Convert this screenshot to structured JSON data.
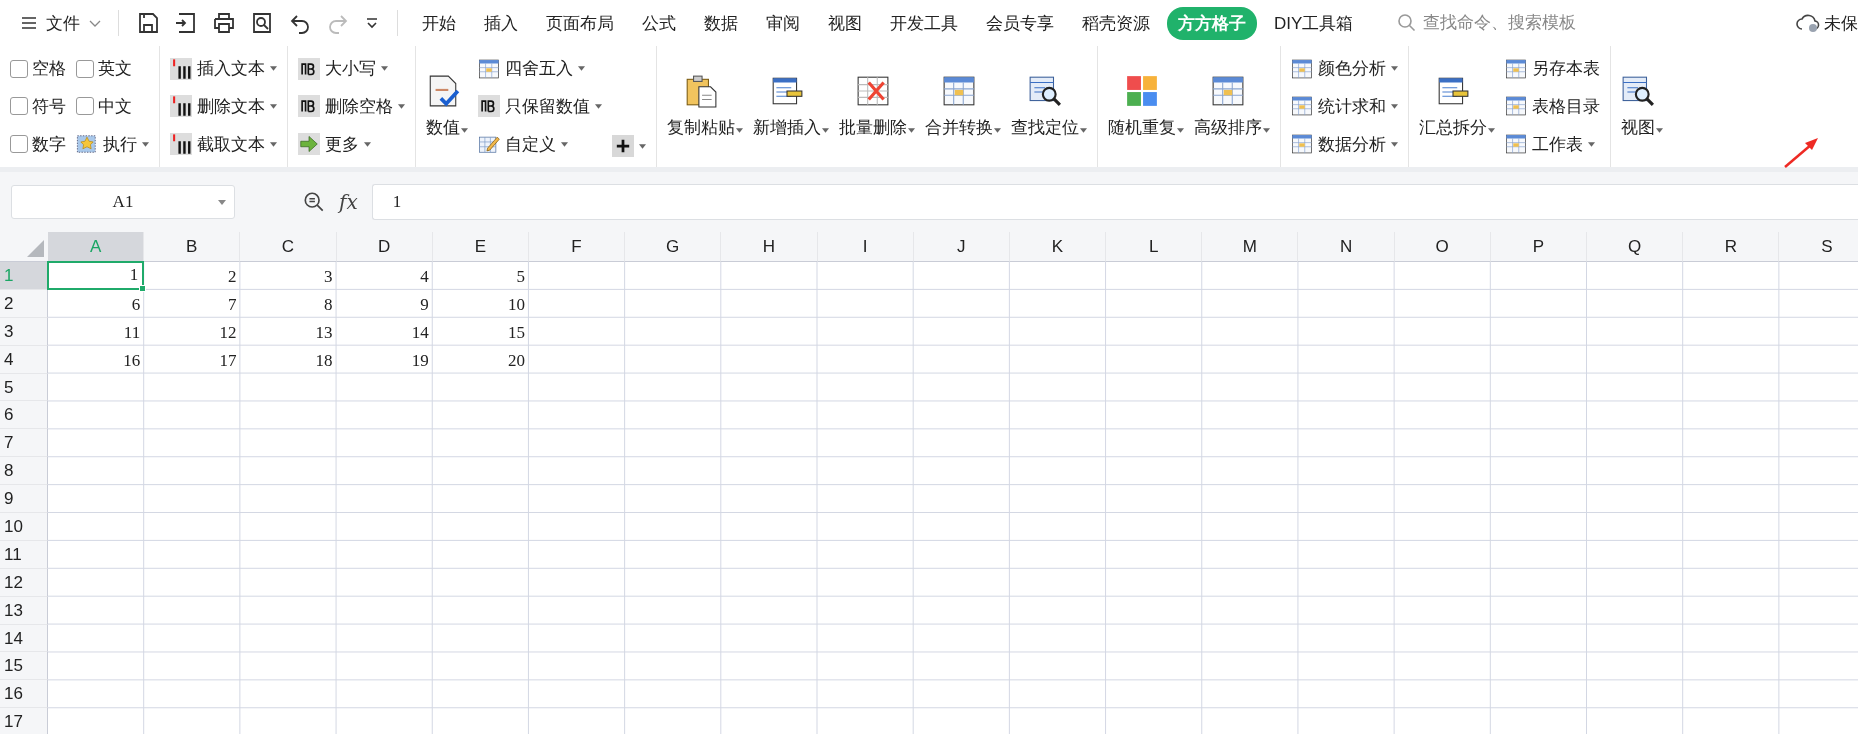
{
  "menu_bar": {
    "file_menu": "文件",
    "tabs": [
      {
        "label": "开始",
        "selected": false
      },
      {
        "label": "插入",
        "selected": false
      },
      {
        "label": "页面布局",
        "selected": false
      },
      {
        "label": "公式",
        "selected": false
      },
      {
        "label": "数据",
        "selected": false
      },
      {
        "label": "审阅",
        "selected": false
      },
      {
        "label": "视图",
        "selected": false
      },
      {
        "label": "开发工具",
        "selected": false
      },
      {
        "label": "会员专享",
        "selected": false
      },
      {
        "label": "稻壳资源",
        "selected": false
      },
      {
        "label": "方方格子",
        "selected": true
      },
      {
        "label": "DIY工具箱",
        "selected": false
      }
    ],
    "search": {
      "placeholder": "查找命令、搜索模板"
    },
    "cloud_status": "未保"
  },
  "ribbon": {
    "groups": [
      {
        "columns": [
          [
            {
              "kind": "checkbox",
              "label": "空格",
              "checked": false
            },
            {
              "kind": "checkbox",
              "label": "符号",
              "checked": false
            },
            {
              "kind": "checkbox",
              "label": "数字",
              "checked": false
            }
          ],
          [
            {
              "kind": "checkbox",
              "label": "英文",
              "checked": false
            },
            {
              "kind": "checkbox",
              "label": "中文",
              "checked": false
            },
            {
              "kind": "small",
              "label": "执行",
              "dropdown": true
            }
          ]
        ]
      },
      {
        "columns": [
          [
            {
              "kind": "small",
              "label": "插入文本",
              "dropdown": true
            },
            {
              "kind": "small",
              "label": "删除文本",
              "dropdown": true
            },
            {
              "kind": "small",
              "label": "截取文本",
              "dropdown": true
            }
          ]
        ]
      },
      {
        "columns": [
          [
            {
              "kind": "small",
              "label": "大小写",
              "dropdown": true
            },
            {
              "kind": "small",
              "label": "删除空格",
              "dropdown": true
            },
            {
              "kind": "small",
              "label": "更多",
              "dropdown": true
            }
          ]
        ]
      },
      {
        "columns": [
          [
            {
              "kind": "large",
              "label": "数值",
              "dropdown": true
            }
          ],
          [
            {
              "kind": "small",
              "label": "四舍五入",
              "dropdown": true
            },
            {
              "kind": "small",
              "label": "只保留数值",
              "dropdown": true
            },
            {
              "kind": "small",
              "label": "自定义",
              "dropdown": true
            }
          ],
          [
            {
              "kind": "icon",
              "dropdown": true
            }
          ]
        ]
      },
      {
        "columns": [
          [
            {
              "kind": "large",
              "label": "复制粘贴",
              "dropdown": true
            }
          ],
          [
            {
              "kind": "large",
              "label": "新增插入",
              "dropdown": true
            }
          ],
          [
            {
              "kind": "large",
              "label": "批量删除",
              "dropdown": true
            }
          ],
          [
            {
              "kind": "large",
              "label": "合并转换",
              "dropdown": true
            }
          ],
          [
            {
              "kind": "large",
              "label": "查找定位",
              "dropdown": true
            }
          ]
        ]
      },
      {
        "columns": [
          [
            {
              "kind": "large",
              "label": "随机重复",
              "dropdown": true
            }
          ],
          [
            {
              "kind": "large",
              "label": "高级排序",
              "dropdown": true
            }
          ]
        ]
      },
      {
        "columns": [
          [
            {
              "kind": "small",
              "label": "颜色分析",
              "dropdown": true
            },
            {
              "kind": "small",
              "label": "统计求和",
              "dropdown": true
            },
            {
              "kind": "small",
              "label": "数据分析",
              "dropdown": true
            }
          ]
        ]
      },
      {
        "columns": [
          [
            {
              "kind": "large",
              "label": "汇总拆分",
              "dropdown": true
            }
          ],
          [
            {
              "kind": "small",
              "label": "另存本表",
              "dropdown": false
            },
            {
              "kind": "small",
              "label": "表格目录",
              "dropdown": false
            },
            {
              "kind": "small",
              "label": "工作表",
              "dropdown": true
            }
          ]
        ]
      },
      {
        "columns": [
          [
            {
              "kind": "large",
              "label": "视图",
              "dropdown": true
            }
          ]
        ]
      }
    ]
  },
  "formula_bar": {
    "name_box": "A1",
    "function_label": "fx",
    "formula": "1"
  },
  "sheet": {
    "columns": [
      {
        "label": "A",
        "selected": true
      },
      {
        "label": "B",
        "selected": false
      },
      {
        "label": "C",
        "selected": false
      },
      {
        "label": "D",
        "selected": false
      },
      {
        "label": "E",
        "selected": false
      },
      {
        "label": "F",
        "selected": false
      },
      {
        "label": "G",
        "selected": false
      },
      {
        "label": "H",
        "selected": false
      },
      {
        "label": "I",
        "selected": false
      },
      {
        "label": "J",
        "selected": false
      },
      {
        "label": "K",
        "selected": false
      },
      {
        "label": "L",
        "selected": false
      },
      {
        "label": "M",
        "selected": false
      },
      {
        "label": "N",
        "selected": false
      },
      {
        "label": "O",
        "selected": false
      },
      {
        "label": "P",
        "selected": false
      },
      {
        "label": "Q",
        "selected": false
      },
      {
        "label": "R",
        "selected": false
      },
      {
        "label": "S",
        "selected": false
      }
    ],
    "rows": [
      {
        "label": "1",
        "selected": true,
        "cells": [
          "1",
          "2",
          "3",
          "4",
          "5"
        ]
      },
      {
        "label": "2",
        "selected": false,
        "cells": [
          "6",
          "7",
          "8",
          "9",
          "10"
        ]
      },
      {
        "label": "3",
        "selected": false,
        "cells": [
          "11",
          "12",
          "13",
          "14",
          "15"
        ]
      },
      {
        "label": "4",
        "selected": false,
        "cells": [
          "16",
          "17",
          "18",
          "19",
          "20"
        ]
      },
      {
        "label": "5",
        "selected": false
      },
      {
        "label": "6",
        "selected": false
      },
      {
        "label": "7",
        "selected": false
      },
      {
        "label": "8",
        "selected": false
      },
      {
        "label": "9",
        "selected": false
      },
      {
        "label": "10",
        "selected": false
      },
      {
        "label": "11",
        "selected": false
      },
      {
        "label": "12",
        "selected": false
      },
      {
        "label": "13",
        "selected": false
      },
      {
        "label": "14",
        "selected": false
      },
      {
        "label": "15",
        "selected": false
      },
      {
        "label": "16",
        "selected": false
      },
      {
        "label": "17",
        "selected": false
      }
    ]
  }
}
